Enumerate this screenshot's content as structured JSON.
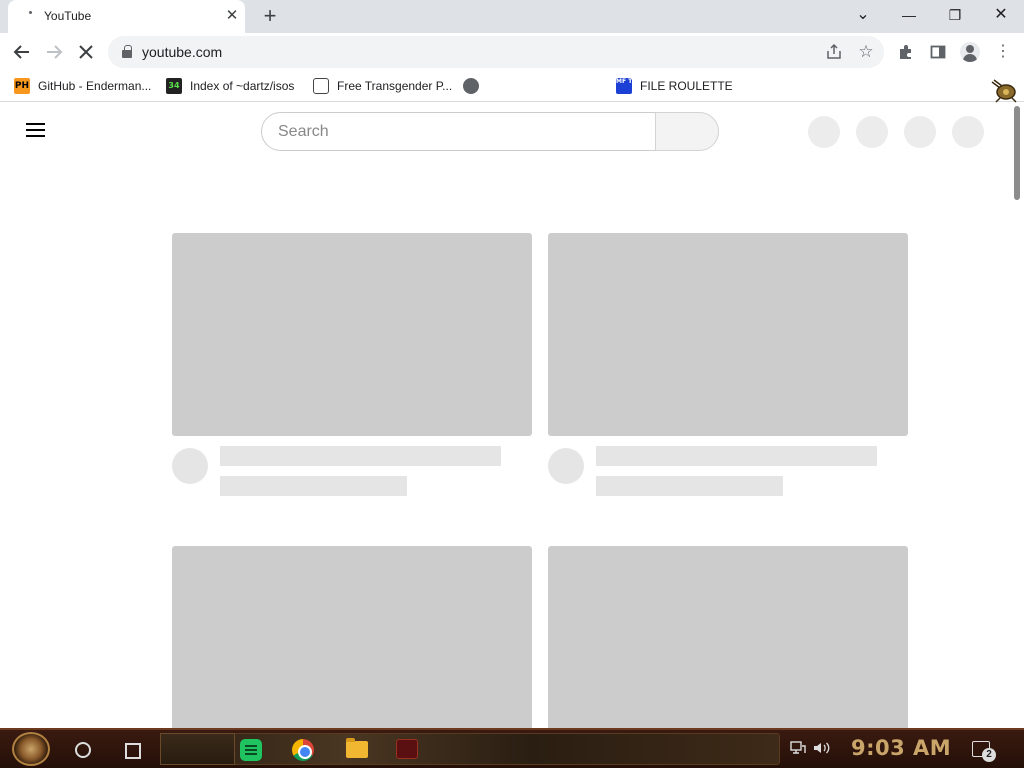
{
  "browser": {
    "tab": {
      "title": "YouTube",
      "close_glyph": "✕"
    },
    "new_tab_glyph": "+",
    "window_controls": {
      "dropdown": "⌄",
      "minimize": "—",
      "restore": "❐",
      "close": "✕"
    },
    "url": "youtube.com"
  },
  "bookmarks": [
    {
      "label": "GitHub - Enderman...",
      "icon": "ph-icon",
      "icon_text": "PH"
    },
    {
      "label": "Index of ~dartz/isos",
      "icon": "34-icon",
      "icon_text": "34"
    },
    {
      "label": "Free Transgender P...",
      "icon": "site-icon",
      "icon_text": ""
    },
    {
      "label": "",
      "icon": "globe-icon",
      "icon_text": ""
    },
    {
      "label": "FILE ROULETTE",
      "icon": "file-roulette-icon",
      "icon_text": "MF T"
    }
  ],
  "youtube": {
    "search_placeholder": "Search"
  },
  "taskbar": {
    "clock": "9:03 AM",
    "notification_count": "2"
  },
  "colors": {
    "skeleton_thumb": "#cccccc",
    "skeleton_line": "#e5e5e5",
    "clock": "#c9a56a"
  }
}
